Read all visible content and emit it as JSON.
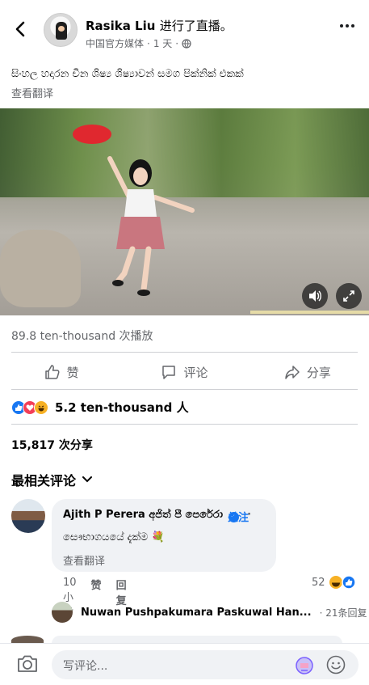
{
  "header": {
    "name": "Rasika Liu",
    "action": "进行了直播。",
    "category": "中国官方媒体",
    "time": "1 天",
    "dot": "·"
  },
  "post": {
    "text": "සිංහල හදාරන චීන ශිෂ්‍ය ශිෂ්‍යාවන් සමග පික්නික් එකක්",
    "translate": "查看翻译"
  },
  "video": {
    "views": "89.8 ten-thousand 次播放"
  },
  "actions": {
    "like": "赞",
    "comment": "评论",
    "share": "分享"
  },
  "reactions": {
    "count": "5.2 ten-thousand 人"
  },
  "shares": "15,817 次分享",
  "sort_label": "最相关评论",
  "comment": {
    "name": "Ajith P Perera අජිත් පී පෙරේරා",
    "dot": "·",
    "follow": "关注",
    "text": "සෞභාගයයේ දැක්ම 💐",
    "translate": "查看翻译",
    "time": "10小时",
    "like": "赞",
    "reply": "回复",
    "react_count": "52"
  },
  "reply_preview": {
    "name": "Nuwan Pushpakumara Paskuwal Han...",
    "count": "· 21条回复"
  },
  "composer": {
    "placeholder": "写评论..."
  },
  "colors": {
    "accent": "#1877f2",
    "muted": "#65676b",
    "bubble": "#f0f2f5"
  }
}
